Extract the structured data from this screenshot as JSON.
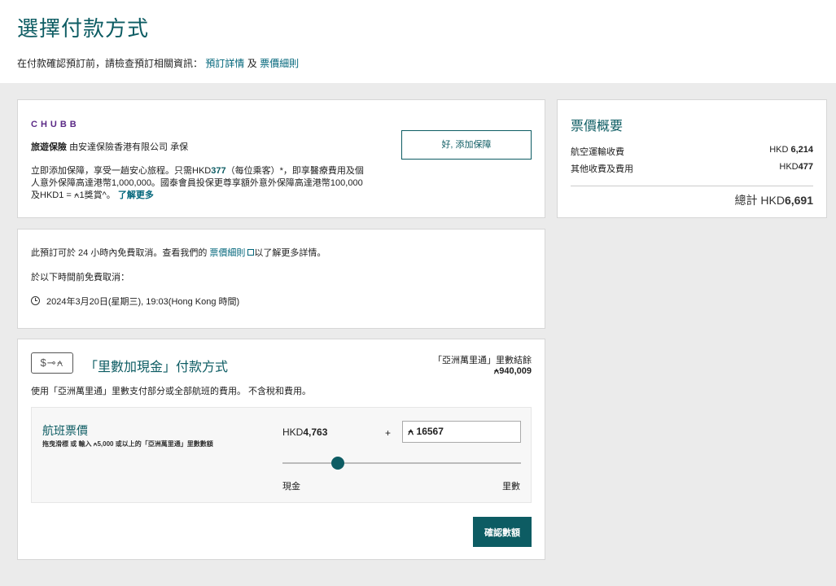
{
  "header": {
    "title": "選擇付款方式",
    "subtitle_prefix": "在付款確認預訂前，請檢查預訂相關資訊：",
    "link_booking": "預訂詳情",
    "connector": "及",
    "link_fare_rules": "票價細則"
  },
  "insurance": {
    "brand": "CHUBB",
    "title_bold": "旅遊保險",
    "title_rest": "由安達保險香港有限公司 承保",
    "desc_1": "立即添加保障，享受一趟安心旅程。只需HKD",
    "price": "377",
    "desc_2": "（每位乘客）*，即享醫療費用及個人意外保障高達港幣1,000,000。國泰會員投保更尊享額外意外保障高達港幣100,000及HKD1 = ⍲1獎賞^。",
    "learn_more": "了解更多",
    "add_button": "好, 添加保障"
  },
  "cancellation": {
    "line1_prefix": "此預訂可於 24 小時內免費取消。查看我們的",
    "line1_link": "票價細則",
    "line1_suffix": "以了解更多詳情。",
    "line2": "於以下時間前免費取消：",
    "deadline": "2024年3月20日(星期三), 19:03(Hong Kong 時間)"
  },
  "summary": {
    "title": "票價概要",
    "rows": [
      {
        "label": "航空運輸收費",
        "currency": "HKD ",
        "amount": "6,214"
      },
      {
        "label": "其他收費及費用",
        "currency": "HKD",
        "amount": "477"
      }
    ],
    "total_prefix": "總計 HKD",
    "total_amount": "6,691"
  },
  "miles_cash": {
    "icon_text": "$⊸⍲",
    "title": "「里數加現金」付款方式",
    "balance_label": "「亞洲萬里通」里數結餘",
    "balance_value": "⍲940,009",
    "description": "使用「亞洲萬里通」里數支付部分或全部航班的費用。 不含稅和費用。",
    "fare_title": "航班票價",
    "fare_hint": "拖曳滑標 或 輸入 ⍲5,000 或以上的「亞洲萬里通」里數數額",
    "cash_prefix": "HKD",
    "cash_amount": "4,763",
    "plus": "+",
    "miles_value": "⍲ 16567",
    "slider_fraction": 0.233,
    "slider_left": "現金",
    "slider_right": "里數",
    "confirm_button": "確認數額"
  }
}
